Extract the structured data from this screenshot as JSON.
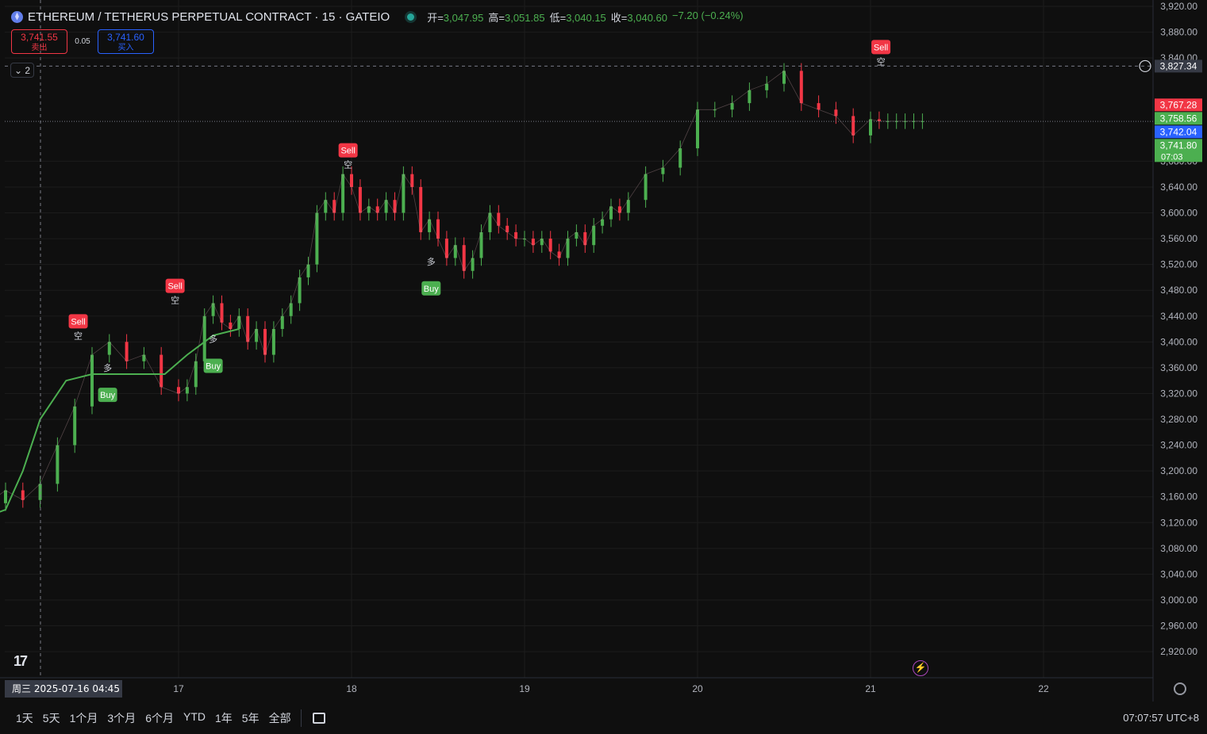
{
  "header": {
    "symbol_title": "ETHEREUM / TETHERUS PERPETUAL CONTRACT · 15 · GATEIO",
    "ohlc": [
      {
        "k": "开=",
        "v": "3,047.95"
      },
      {
        "k": "高=",
        "v": "3,051.85"
      },
      {
        "k": "低=",
        "v": "3,040.15"
      },
      {
        "k": "收=",
        "v": "3,040.60"
      },
      {
        "k": "",
        "v": "−7.20 (−0.24%)"
      }
    ]
  },
  "trade": {
    "sell_price": "3,741.55",
    "sell_label": "卖出",
    "spread": "0.05",
    "buy_price": "3,741.60",
    "buy_label": "买入"
  },
  "collapse_label": "⌄ 2",
  "logo_text": "17",
  "chart_data": {
    "type": "line",
    "title": "",
    "ylim": [
      2900,
      3920
    ],
    "y_ticks": [
      "3,920.00",
      "3,880.00",
      "3,840.00",
      "3,680.00",
      "3,640.00",
      "3,600.00",
      "3,560.00",
      "3,520.00",
      "3,480.00",
      "3,440.00",
      "3,400.00",
      "3,360.00",
      "3,320.00",
      "3,280.00",
      "3,240.00",
      "3,200.00",
      "3,160.00",
      "3,120.00",
      "3,080.00",
      "3,040.00",
      "3,000.00",
      "2,960.00",
      "2,920.00"
    ],
    "y_tick_values": [
      3920,
      3880,
      3840,
      3680,
      3640,
      3600,
      3560,
      3520,
      3480,
      3440,
      3400,
      3360,
      3320,
      3280,
      3240,
      3200,
      3160,
      3120,
      3080,
      3040,
      3000,
      2960,
      2920
    ],
    "x_ticks": [
      "17",
      "18",
      "19",
      "20",
      "21",
      "22"
    ],
    "x_tick_days": [
      1,
      2,
      3,
      4,
      5,
      6
    ],
    "crosshair_time_label": "周三 2025-07-16   04:45",
    "crosshair_day": 0.0,
    "crosshair_price": 3827.34,
    "price_series": {
      "name": "",
      "x_days": [
        -0.98,
        -0.9,
        -0.8,
        -0.7,
        -0.6,
        -0.5,
        -0.4,
        -0.3,
        -0.2,
        -0.1,
        0,
        0.1,
        0.2,
        0.3,
        0.4,
        0.5,
        0.6,
        0.7,
        0.8,
        0.9,
        1.0,
        1.05,
        1.1,
        1.15,
        1.2,
        1.25,
        1.3,
        1.35,
        1.4,
        1.45,
        1.5,
        1.55,
        1.6,
        1.65,
        1.7,
        1.75,
        1.8,
        1.85,
        1.9,
        1.95,
        2.0,
        2.05,
        2.1,
        2.15,
        2.2,
        2.25,
        2.3,
        2.35,
        2.4,
        2.45,
        2.5,
        2.55,
        2.6,
        2.65,
        2.7,
        2.75,
        2.8,
        2.85,
        2.9,
        2.95,
        3.0,
        3.05,
        3.1,
        3.15,
        3.2,
        3.25,
        3.3,
        3.35,
        3.4,
        3.45,
        3.5,
        3.55,
        3.6,
        3.7,
        3.8,
        3.9,
        4.0,
        4.1,
        4.2,
        4.3,
        4.4,
        4.5,
        4.6,
        4.7,
        4.8,
        4.9,
        5.0,
        5.05,
        5.1,
        5.15,
        5.2,
        5.25,
        5.3
      ],
      "values": [
        2990,
        3060,
        3050,
        3080,
        3120,
        3140,
        3100,
        3150,
        3160,
        3150,
        3170,
        3155,
        3180,
        3240,
        3300,
        3380,
        3400,
        3370,
        3380,
        3330,
        3320,
        3330,
        3370,
        3440,
        3460,
        3430,
        3420,
        3440,
        3400,
        3420,
        3380,
        3420,
        3440,
        3460,
        3500,
        3520,
        3600,
        3620,
        3600,
        3660,
        3640,
        3600,
        3610,
        3600,
        3620,
        3600,
        3660,
        3640,
        3570,
        3590,
        3560,
        3530,
        3550,
        3510,
        3530,
        3570,
        3600,
        3580,
        3570,
        3560,
        3560,
        3550,
        3560,
        3540,
        3530,
        3560,
        3570,
        3550,
        3580,
        3590,
        3610,
        3600,
        3620,
        3660,
        3670,
        3700,
        3760,
        3760,
        3770,
        3790,
        3800,
        3820,
        3770,
        3760,
        3750,
        3720,
        3745,
        3742,
        3742,
        3742,
        3742,
        3742,
        3742
      ]
    },
    "supertrend_up": {
      "name": "",
      "x_days": [
        -0.98,
        -0.85,
        -0.7,
        -0.5,
        -0.35,
        -0.2,
        0.0,
        0.1,
        0.2,
        0.35,
        0.5,
        0.7,
        0.92,
        1.05,
        1.2,
        1.35
      ],
      "values": [
        3040,
        3040,
        3090,
        3090,
        3120,
        3120,
        3140,
        3200,
        3280,
        3340,
        3350,
        3350,
        3350,
        3380,
        3410,
        3420
      ]
    },
    "price_labels": [
      {
        "text": "3,827.34",
        "value": 3827.34,
        "color": "#363a45"
      },
      {
        "text": "3,767.28",
        "value": 3767.28,
        "color": "#f23645"
      },
      {
        "text": "3,758.56",
        "value": 3758.56,
        "color": "#4caf50"
      },
      {
        "text": "3,742.04",
        "value": 3742.04,
        "color": "#2962ff"
      },
      {
        "text": "3,741.80",
        "value": 3741.8,
        "color": "#4caf50"
      }
    ],
    "countdown": "07:03",
    "signals": [
      {
        "type": "Buy",
        "day": -0.98,
        "price": 2990
      },
      {
        "type": "Sell",
        "day": 0.42,
        "price": 3395
      },
      {
        "type": "Buy",
        "day": 0.59,
        "price": 3345
      },
      {
        "type": "Sell",
        "day": 0.98,
        "price": 3450
      },
      {
        "type": "Buy",
        "day": 1.2,
        "price": 3390
      },
      {
        "type": "Sell",
        "day": 1.98,
        "price": 3660
      },
      {
        "type": "Buy",
        "day": 2.46,
        "price": 3510
      },
      {
        "type": "Sell",
        "day": 5.06,
        "price": 3820
      }
    ],
    "signal_labels": {
      "Buy": "Buy",
      "Sell": "Sell",
      "long": "多",
      "short": "空"
    }
  },
  "timeframes": [
    "1天",
    "5天",
    "1个月",
    "3个月",
    "6个月",
    "YTD",
    "1年",
    "5年",
    "全部"
  ],
  "clock": "07:07:57 UTC+8",
  "colors": {
    "bg": "#0f0f0f",
    "grid": "#1c1c1c",
    "up": "#4caf50",
    "down": "#f23645",
    "accent": "#2962ff"
  }
}
